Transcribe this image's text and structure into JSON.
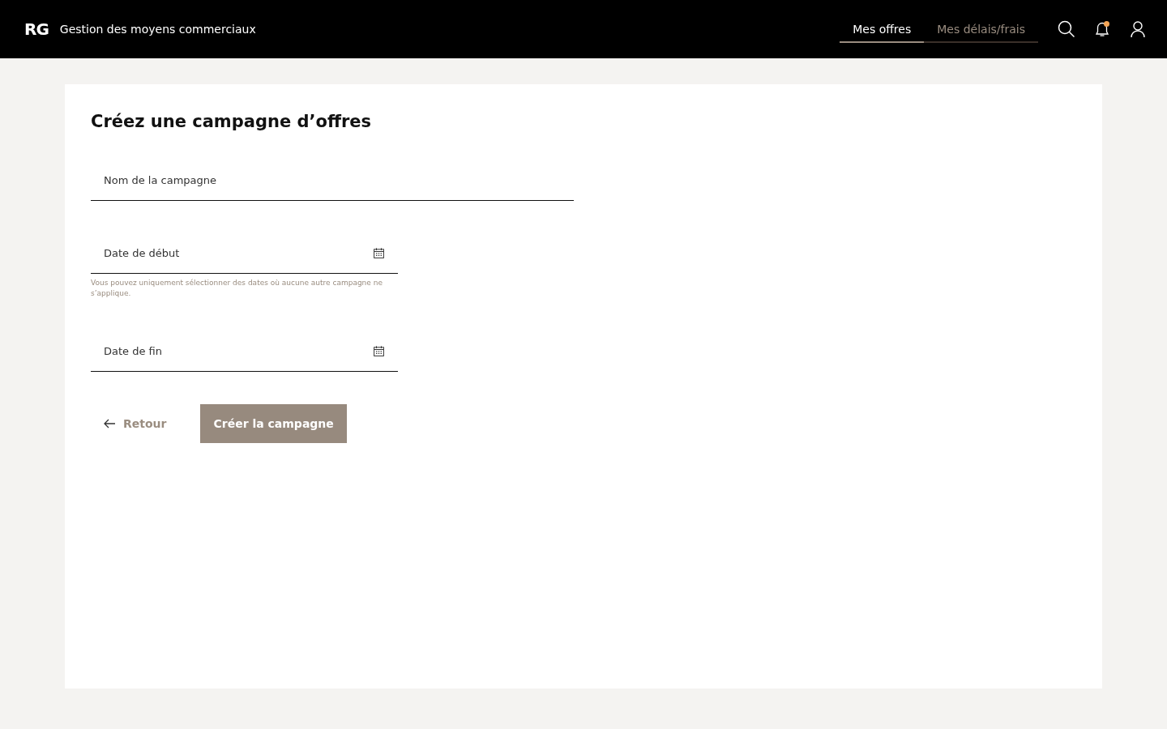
{
  "header": {
    "logo": "RG",
    "app_title": "Gestion des moyens commerciaux",
    "unread_notifications": true
  },
  "tabs": [
    {
      "label": "Mes offres",
      "selected": true
    },
    {
      "label": "Mes délais/frais",
      "selected": false
    }
  ],
  "form": {
    "title": "Créez une campagne d’offres",
    "fields": [
      {
        "kind": "text",
        "placeholder": "Nom de la campagne"
      },
      {
        "kind": "date",
        "placeholder": "Date de début",
        "hint": "Vous pouvez uniquement sélectionner des dates où aucune autre campagne ne s’applique."
      },
      {
        "kind": "date",
        "placeholder": "Date de fin"
      }
    ],
    "back_label": "Retour",
    "submit": {
      "label": "Créer la campagne",
      "disabled": true
    }
  }
}
